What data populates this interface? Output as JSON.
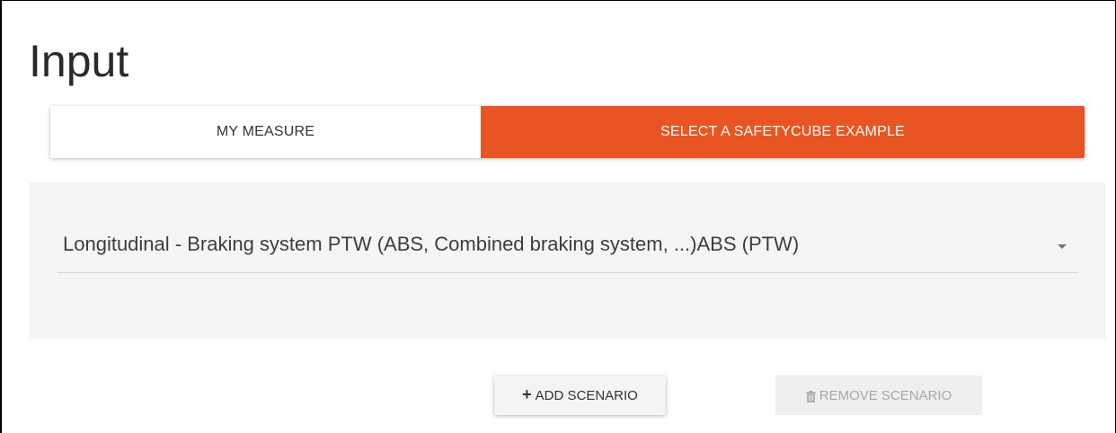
{
  "page": {
    "title": "Input"
  },
  "tabs": [
    {
      "label": "MY MEASURE",
      "active": false
    },
    {
      "label": "SELECT A SAFETYCUBE EXAMPLE",
      "active": true
    }
  ],
  "example_select": {
    "value": "Longitudinal - Braking system PTW (ABS, Combined braking system, ...)ABS (PTW)"
  },
  "actions": {
    "add_label": "ADD SCENARIO",
    "remove_label": "REMOVE SCENARIO"
  },
  "colors": {
    "accent": "#e95522",
    "panel_background": "#f5f5f5",
    "disabled_text": "#a8a8a8"
  },
  "icons": {
    "add": "plus-icon",
    "remove": "trash-icon",
    "select": "caret-down-icon"
  }
}
